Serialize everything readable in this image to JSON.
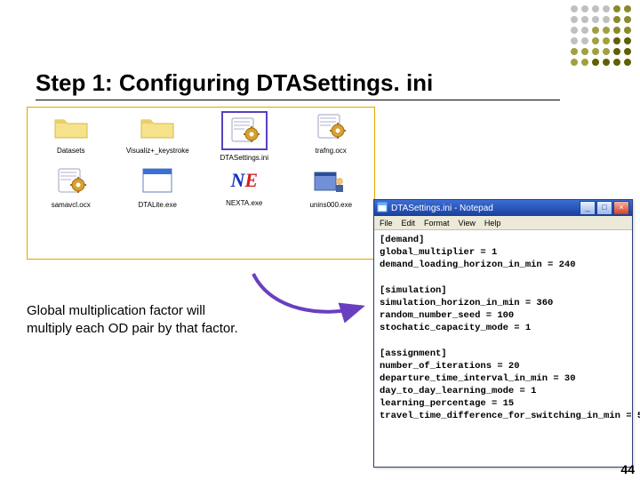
{
  "title": "Step 1: Configuring DTASettings. ini",
  "dots_pattern": [
    [
      "c1",
      "c1",
      "c1",
      "c1",
      "c2",
      "c2"
    ],
    [
      "c1",
      "c1",
      "c1",
      "c1",
      "c2",
      "c2"
    ],
    [
      "c1",
      "c1",
      "c3",
      "c3",
      "c2",
      "c2"
    ],
    [
      "c1",
      "c1",
      "c3",
      "c3",
      "c4",
      "c4"
    ],
    [
      "c3",
      "c3",
      "c3",
      "c3",
      "c4",
      "c4"
    ],
    [
      "c3",
      "c3",
      "c4",
      "c4",
      "c4",
      "c4"
    ]
  ],
  "explorer": {
    "row1": [
      {
        "name": "Datasets",
        "icon": "folder"
      },
      {
        "name": "Visualiz+_keystroke",
        "icon": "folder"
      },
      {
        "name": "DTASettings.ini",
        "icon": "gear",
        "highlight": true
      },
      {
        "name": "trafng.ocx",
        "icon": "gear"
      }
    ],
    "row2": [
      {
        "name": "samavcl.ocx",
        "icon": "gear"
      },
      {
        "name": "DTALite.exe",
        "icon": "window"
      },
      {
        "name": "NEXTA.exe",
        "icon": "ne"
      },
      {
        "name": "unins000.exe",
        "icon": "wizard"
      }
    ]
  },
  "annotation_line1": "Global multiplication factor will",
  "annotation_line2": "multiply each OD pair by that factor.",
  "notepad": {
    "title": "DTASettings.ini - Notepad",
    "menu": [
      "File",
      "Edit",
      "Format",
      "View",
      "Help"
    ],
    "body": "[demand]\nglobal_multiplier = 1\ndemand_loading_horizon_in_min = 240\n\n[simulation]\nsimulation_horizon_in_min = 360\nrandom_number_seed = 100\nstochatic_capacity_mode = 1\n\n[assignment]\nnumber_of_iterations = 20\ndeparture_time_interval_in_min = 30\nday_to_day_learning_mode = 1\nlearning_percentage = 15\ntravel_time_difference_for_switching_in_min = 5"
  },
  "page_number": "44"
}
